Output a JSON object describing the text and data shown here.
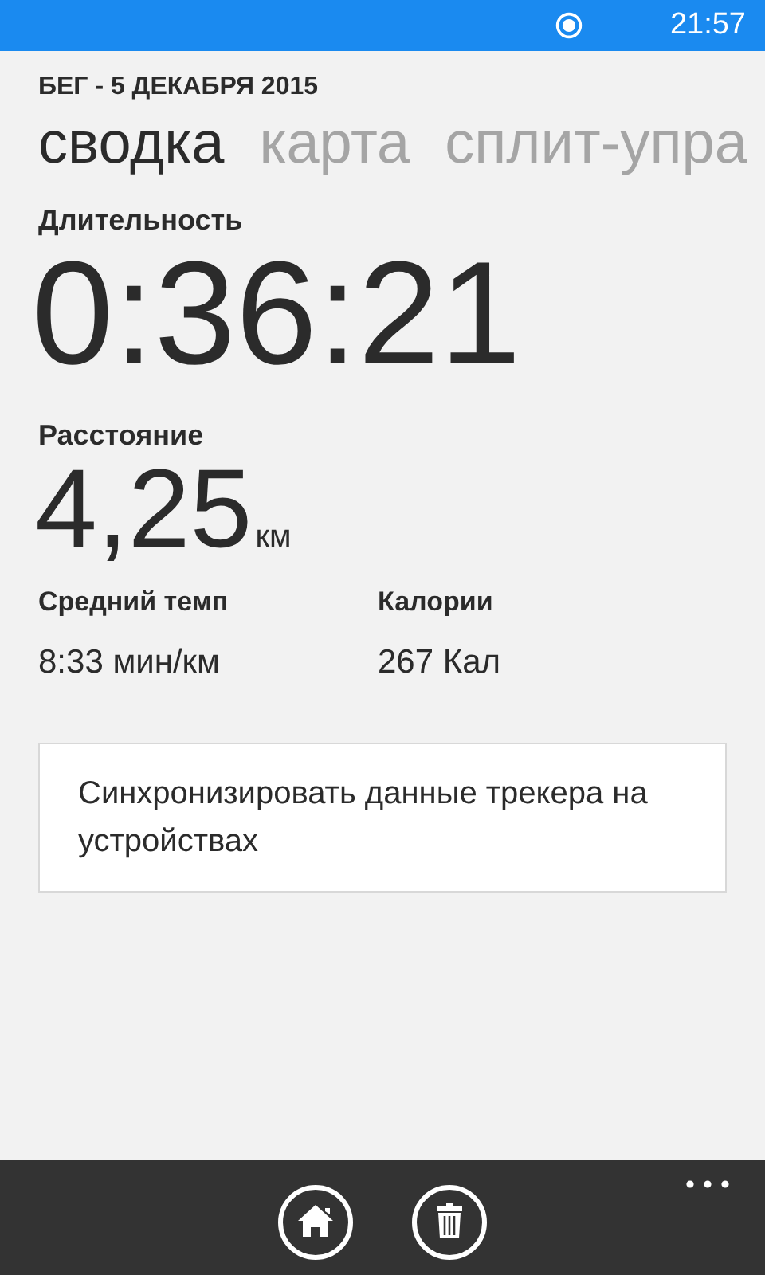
{
  "status_bar": {
    "time": "21:57"
  },
  "header": {
    "title": "БЕГ - 5 ДЕКАБРЯ 2015"
  },
  "tabs": [
    {
      "label": "сводка",
      "selected": true
    },
    {
      "label": "карта",
      "selected": false
    },
    {
      "label": "сплит-упра",
      "selected": false
    }
  ],
  "duration": {
    "label": "Длительность",
    "value": "0:36:21"
  },
  "distance": {
    "label": "Расстояние",
    "value": "4,25",
    "unit": "км"
  },
  "stats": [
    {
      "label": "Средний темп",
      "value": "8:33 мин/км"
    },
    {
      "label": "Калории",
      "value": "267 Кал"
    }
  ],
  "sync_button": {
    "label": "Синхронизировать данные трекера на устройствах"
  },
  "app_bar": {
    "buttons": [
      {
        "kind": "home"
      },
      {
        "kind": "delete"
      }
    ]
  }
}
